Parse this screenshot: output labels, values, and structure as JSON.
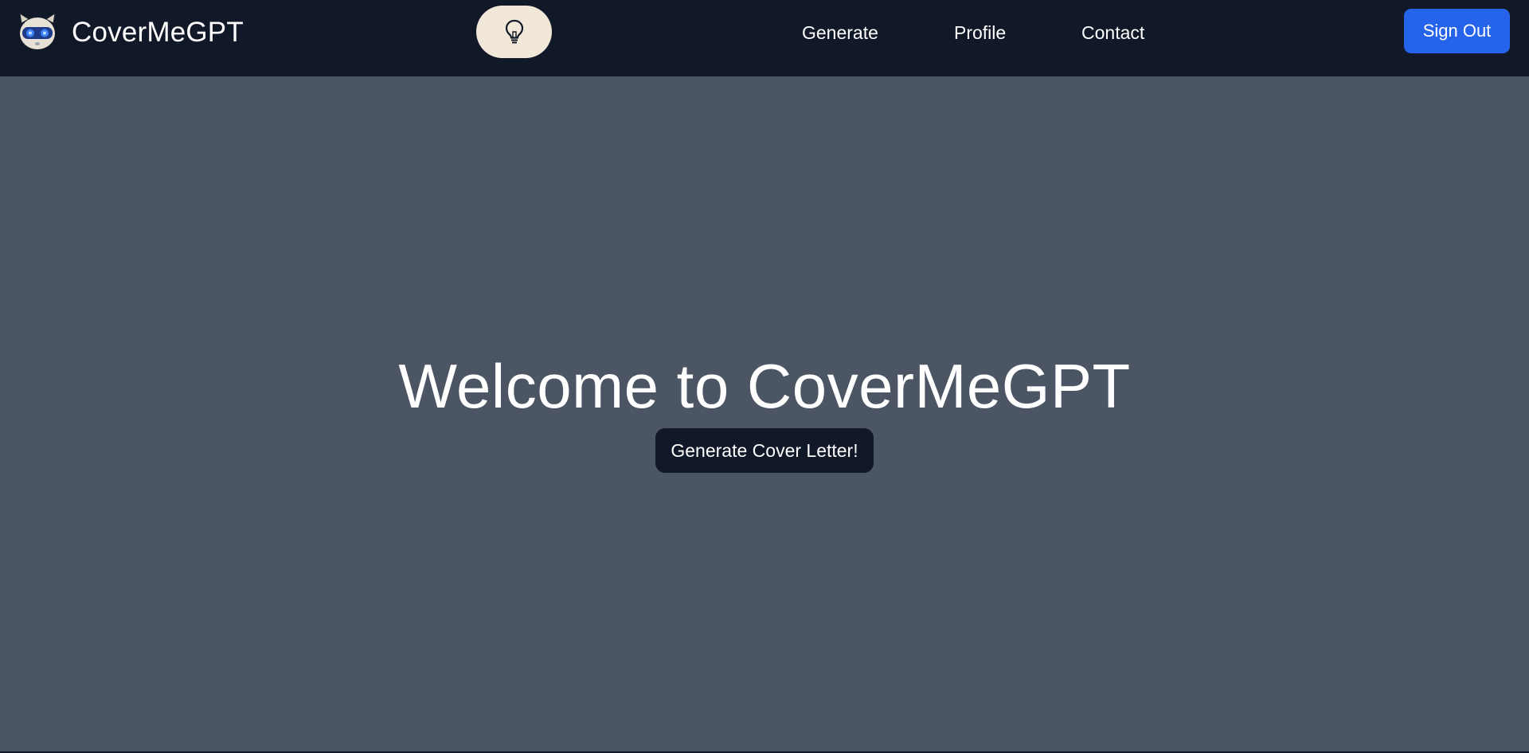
{
  "app": {
    "name": "CoverMeGPT",
    "logo_icon": "robot-mascot-icon"
  },
  "navbar": {
    "theme_toggle_icon": "lightbulb-icon",
    "links": [
      {
        "label": "Generate"
      },
      {
        "label": "Profile"
      },
      {
        "label": "Contact"
      }
    ],
    "sign_out_label": "Sign Out"
  },
  "hero": {
    "title": "Welcome to CoverMeGPT",
    "cta_label": "Generate Cover Letter!"
  },
  "colors": {
    "navbar_bg": "#111827",
    "page_bg": "#4b5563",
    "accent_button": "#2563eb",
    "toggle_bg": "#f1e8da",
    "text": "#ffffff"
  }
}
